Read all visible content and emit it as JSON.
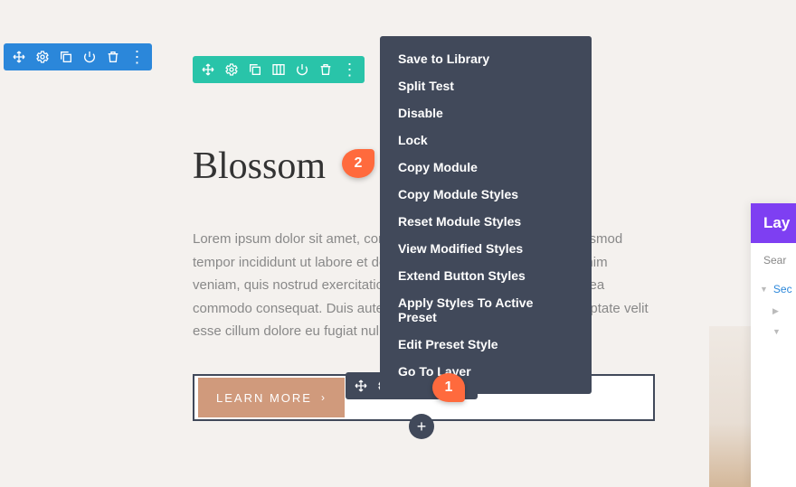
{
  "section_toolbar": {
    "icons": [
      "move-icon",
      "settings-icon",
      "duplicate-icon",
      "power-icon",
      "trash-icon",
      "more-icon"
    ]
  },
  "row_toolbar": {
    "icons": [
      "move-icon",
      "settings-icon",
      "duplicate-icon",
      "columns-icon",
      "power-icon",
      "trash-icon",
      "more-icon"
    ]
  },
  "module_toolbar": {
    "icons": [
      "move-icon",
      "settings-icon",
      "duplicate-icon",
      "more-icon"
    ]
  },
  "content": {
    "title": "Blossom",
    "body": "Lorem ipsum dolor sit amet, consectetur adipiscing elit, sed do eiusmod tempor incididunt ut labore et dolore magna aliqua. Ut enim ad minim veniam, quis nostrud exercitation ullamco laboris nisi ut aliquip ex ea commodo consequat. Duis aute irure dolor in reprehenderit in voluptate velit esse cillum dolore eu fugiat nulla pariatur."
  },
  "button": {
    "label": "LEARN MORE"
  },
  "menu": {
    "items": [
      "Save to Library",
      "Split Test",
      "Disable",
      "Lock",
      "Copy Module",
      "Copy Module Styles",
      "Reset Module Styles",
      "View Modified Styles",
      "Extend Button Styles",
      "Apply Styles To Active Preset",
      "Edit Preset Style",
      "Go To Layer"
    ]
  },
  "callouts": {
    "one": "1",
    "two": "2"
  },
  "panel": {
    "title": "Lay",
    "search": "Sear",
    "section_label": "Sec"
  },
  "add_button": {
    "label": "+"
  }
}
